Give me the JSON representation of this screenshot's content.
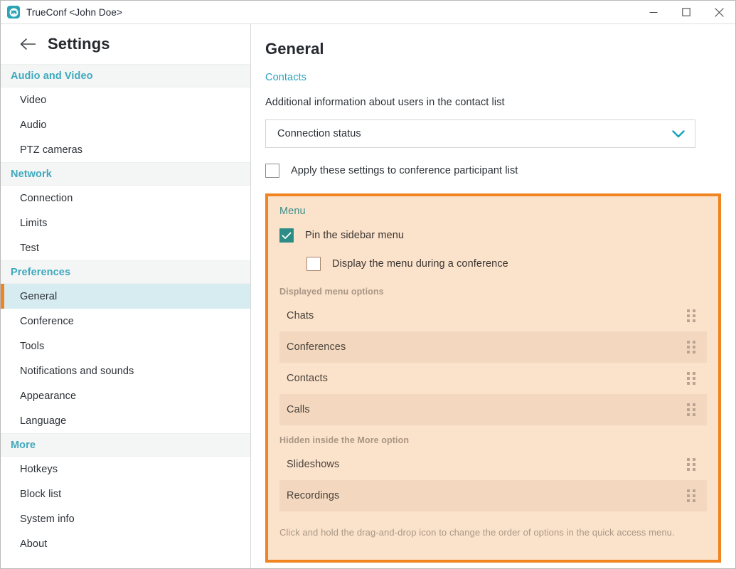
{
  "window": {
    "title": "TrueConf <John Doe>",
    "logo_icon": "trueconf-logo-icon",
    "minimize_label": "Minimize",
    "maximize_label": "Maximize",
    "close_label": "Close"
  },
  "sidebar": {
    "back_icon": "back-arrow-icon",
    "title": "Settings",
    "groups": [
      {
        "label": "Audio and Video",
        "items": [
          {
            "label": "Video",
            "selected": false
          },
          {
            "label": "Audio",
            "selected": false
          },
          {
            "label": "PTZ cameras",
            "selected": false
          }
        ]
      },
      {
        "label": "Network",
        "items": [
          {
            "label": "Connection",
            "selected": false
          },
          {
            "label": "Limits",
            "selected": false
          },
          {
            "label": "Test",
            "selected": false
          }
        ]
      },
      {
        "label": "Preferences",
        "items": [
          {
            "label": "General",
            "selected": true
          },
          {
            "label": "Conference",
            "selected": false
          },
          {
            "label": "Tools",
            "selected": false
          },
          {
            "label": "Notifications and sounds",
            "selected": false
          },
          {
            "label": "Appearance",
            "selected": false
          },
          {
            "label": "Language",
            "selected": false
          }
        ]
      },
      {
        "label": "More",
        "items": [
          {
            "label": "Hotkeys",
            "selected": false
          },
          {
            "label": "Block list",
            "selected": false
          },
          {
            "label": "System info",
            "selected": false
          },
          {
            "label": "About",
            "selected": false
          }
        ]
      }
    ]
  },
  "main": {
    "page_title": "General",
    "contacts_section": {
      "heading": "Contacts",
      "description": "Additional information about users in the contact list",
      "select": {
        "value": "Connection status",
        "chevron_icon": "chevron-down-icon"
      },
      "apply_checkbox": {
        "label": "Apply these settings to conference participant list",
        "checked": false
      }
    },
    "menu_section": {
      "heading": "Menu",
      "pin_checkbox": {
        "label": "Pin the sidebar menu",
        "checked": true
      },
      "display_checkbox": {
        "label": "Display the menu during a conference",
        "checked": false
      },
      "displayed_label": "Displayed menu options",
      "displayed_options": [
        {
          "label": "Chats"
        },
        {
          "label": "Conferences"
        },
        {
          "label": "Contacts"
        },
        {
          "label": "Calls"
        }
      ],
      "hidden_label": "Hidden inside the More option",
      "hidden_options": [
        {
          "label": "Slideshows"
        },
        {
          "label": "Recordings"
        }
      ],
      "footer_note": "Click and hold the drag-and-drop icon to change the order of options in the quick access menu.",
      "drag_icon": "drag-and-drop-icon"
    }
  },
  "colors": {
    "accent_orange": "#f08421",
    "accent_teal": "#2ba3bd",
    "checkbox_teal": "#2c8d87",
    "panel_bg": "#fbe2cb",
    "panel_row_alt": "#f3d8bf",
    "selected_item_bg": "#d6ecf0"
  }
}
